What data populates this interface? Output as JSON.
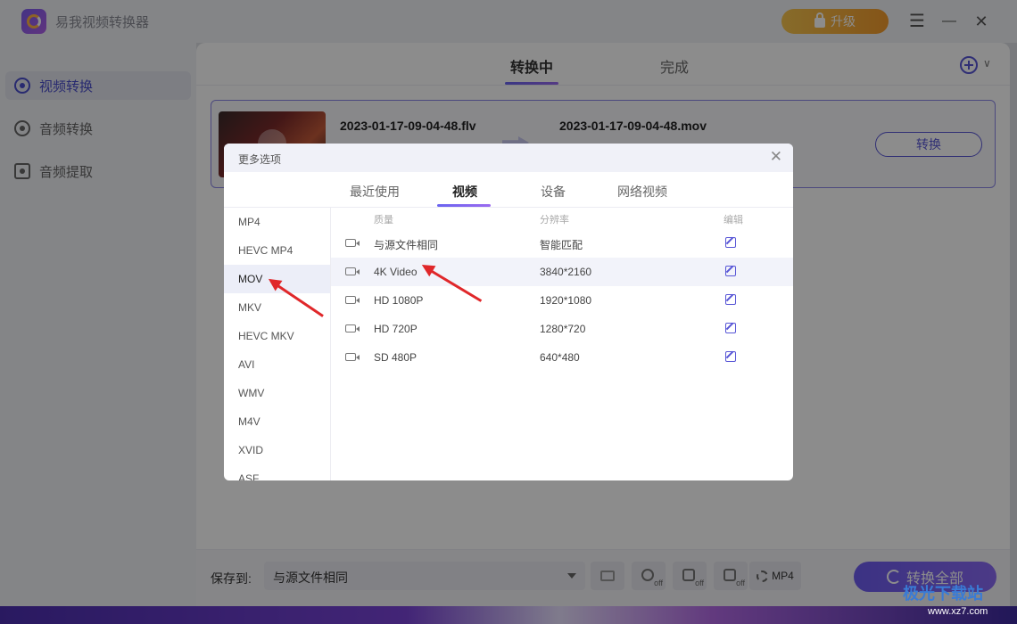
{
  "app": {
    "title": "易我视频转换器",
    "upgrade_label": "升级"
  },
  "window": {
    "menu": "☰",
    "minimize": "—",
    "close": "✕"
  },
  "sidebar": {
    "items": [
      {
        "label": "视频转换",
        "active": true
      },
      {
        "label": "音频转换",
        "active": false
      },
      {
        "label": "音频提取",
        "active": false
      }
    ]
  },
  "main": {
    "tabs": [
      {
        "label": "转换中",
        "active": true
      },
      {
        "label": "完成",
        "active": false
      }
    ],
    "file": {
      "source": "2023-01-17-09-04-48.flv",
      "target": "2023-01-17-09-04-48.mov",
      "convert_label": "转换"
    }
  },
  "bottom": {
    "save_label": "保存到:",
    "save_value": "与源文件相同",
    "tool_off_label": "off",
    "format_label": "MP4",
    "convert_all_label": "转换全部"
  },
  "watermark": {
    "text": "极光下载站",
    "sub": "www.xz7.com"
  },
  "dialog": {
    "title": "更多选项",
    "tabs": [
      {
        "label": "最近使用",
        "active": false
      },
      {
        "label": "视频",
        "active": true
      },
      {
        "label": "设备",
        "active": false
      },
      {
        "label": "网络视频",
        "active": false
      }
    ],
    "formats": [
      "MP4",
      "HEVC MP4",
      "MOV",
      "MKV",
      "HEVC MKV",
      "AVI",
      "WMV",
      "M4V",
      "XVID",
      "ASF"
    ],
    "selected_format": "MOV",
    "columns": {
      "quality": "质量",
      "resolution": "分辨率",
      "edit": "编辑"
    },
    "rows": [
      {
        "name": "与源文件相同",
        "resolution": "智能匹配"
      },
      {
        "name": "4K Video",
        "resolution": "3840*2160"
      },
      {
        "name": "HD 1080P",
        "resolution": "1920*1080"
      },
      {
        "name": "HD 720P",
        "resolution": "1280*720"
      },
      {
        "name": "SD 480P",
        "resolution": "640*480"
      }
    ],
    "highlighted_row": 1
  },
  "colors": {
    "accent": "#5856d6",
    "upgrade": "#f2a33a",
    "annotation": "#e0272a"
  }
}
